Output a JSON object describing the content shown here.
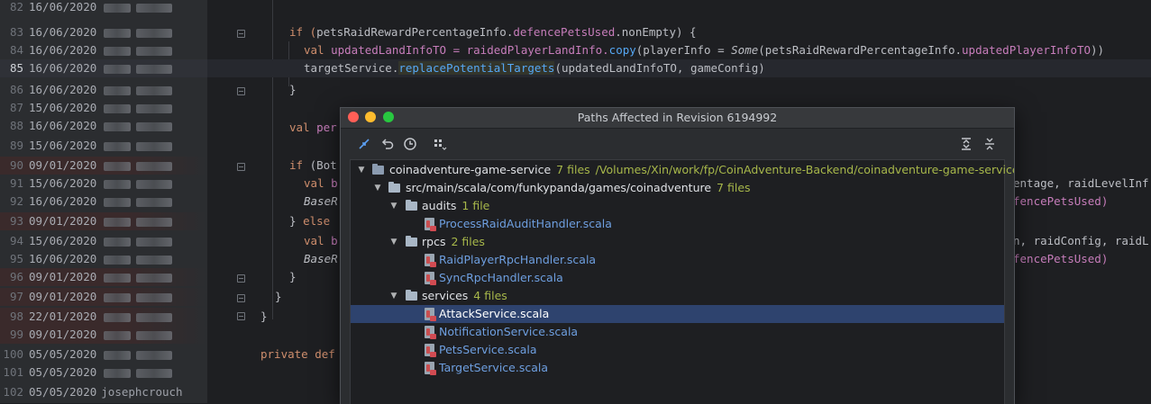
{
  "gutter": {
    "rows": [
      {
        "line": "82",
        "date": "16/06/2020"
      },
      {
        "line": "83",
        "date": "16/06/2020"
      },
      {
        "line": "84",
        "date": "16/06/2020"
      },
      {
        "line": "85",
        "date": "16/06/2020"
      },
      {
        "line": "86",
        "date": "16/06/2020"
      },
      {
        "line": "87",
        "date": "15/06/2020"
      },
      {
        "line": "88",
        "date": "16/06/2020"
      },
      {
        "line": "89",
        "date": "15/06/2020"
      },
      {
        "line": "90",
        "date": "09/01/2020"
      },
      {
        "line": "91",
        "date": "15/06/2020"
      },
      {
        "line": "92",
        "date": "16/06/2020"
      },
      {
        "line": "93",
        "date": "09/01/2020"
      },
      {
        "line": "94",
        "date": "15/06/2020"
      },
      {
        "line": "95",
        "date": "16/06/2020"
      },
      {
        "line": "96",
        "date": "09/01/2020"
      },
      {
        "line": "97",
        "date": "09/01/2020"
      },
      {
        "line": "98",
        "date": "22/01/2020"
      },
      {
        "line": "99",
        "date": "09/01/2020"
      },
      {
        "line": "100",
        "date": "05/05/2020"
      },
      {
        "line": "101",
        "date": "05/05/2020"
      },
      {
        "line": "102",
        "date": "05/05/2020",
        "author": "josephcrouch"
      }
    ]
  },
  "code": {
    "l83_if": "if (",
    "l83_obj": "petsRaidRewardPercentageInfo.",
    "l83_fld": "defencePetsUsed",
    "l83_rest": ".nonEmpty) {",
    "l84_val": "val ",
    "l84_a": "updatedLandInfoTO = raidedPlayerLandInfo.",
    "l84_copy": "copy",
    "l84_b": "(playerInfo = ",
    "l84_some": "Some",
    "l84_c": "(petsRaidRewardPercentageInfo.",
    "l84_fld": "updatedPlayerInfoTO",
    "l84_d": "))",
    "l85_a": "targetService.",
    "l85_fn": "replacePotentialTargets",
    "l85_b": "(updatedLandInfoTO, gameConfig)",
    "l86": "}",
    "l88_kw": "val ",
    "l88_a": "per",
    "l90_kw": "if ",
    "l90_a": "(Bot",
    "l91_kw": "val ",
    "l91_a": "b",
    "l91_r": "entage, raidLevelInf",
    "l92_a": "BaseR",
    "l92_r": "fencePetsUsed)",
    "l93_a": "} ",
    "l93_kw": "else",
    "l94_kw": "val ",
    "l94_a": "b",
    "l94_r": "n, raidConfig, raidL",
    "l95_a": "BaseR",
    "l95_r": "fencePetsUsed)",
    "l96": "}",
    "l97": "}",
    "l98": "}",
    "l100_kw": "private def",
    "l100_a": ""
  },
  "dialog": {
    "title": "Paths Affected in Revision 6194992",
    "toolbar": {
      "diff_icon": "diff-arrows-icon",
      "revert_icon": "undo-icon",
      "history_icon": "clock-icon",
      "group_icon": "group-by-icon",
      "expand_icon": "expand-all-icon",
      "collapse_icon": "collapse-all-icon"
    },
    "tree": {
      "root": {
        "name": "coinadventure-game-service",
        "count": "7 files",
        "path": "/Volumes/Xin/work/fp/CoinAdventure-Backend/coinadventure-game-service"
      },
      "src": {
        "name": "src/main/scala/com/funkypanda/games/coinadventure",
        "count": "7 files"
      },
      "audits": {
        "name": "audits",
        "count": "1 file"
      },
      "audit_file": "ProcessRaidAuditHandler.scala",
      "rpcs": {
        "name": "rpcs",
        "count": "2 files"
      },
      "rpc_file1": "RaidPlayerRpcHandler.scala",
      "rpc_file2": "SyncRpcHandler.scala",
      "services": {
        "name": "services",
        "count": "4 files"
      },
      "svc_file1": "AttackService.scala",
      "svc_file2": "NotificationService.scala",
      "svc_file3": "PetsService.scala",
      "svc_file4": "TargetService.scala"
    }
  }
}
